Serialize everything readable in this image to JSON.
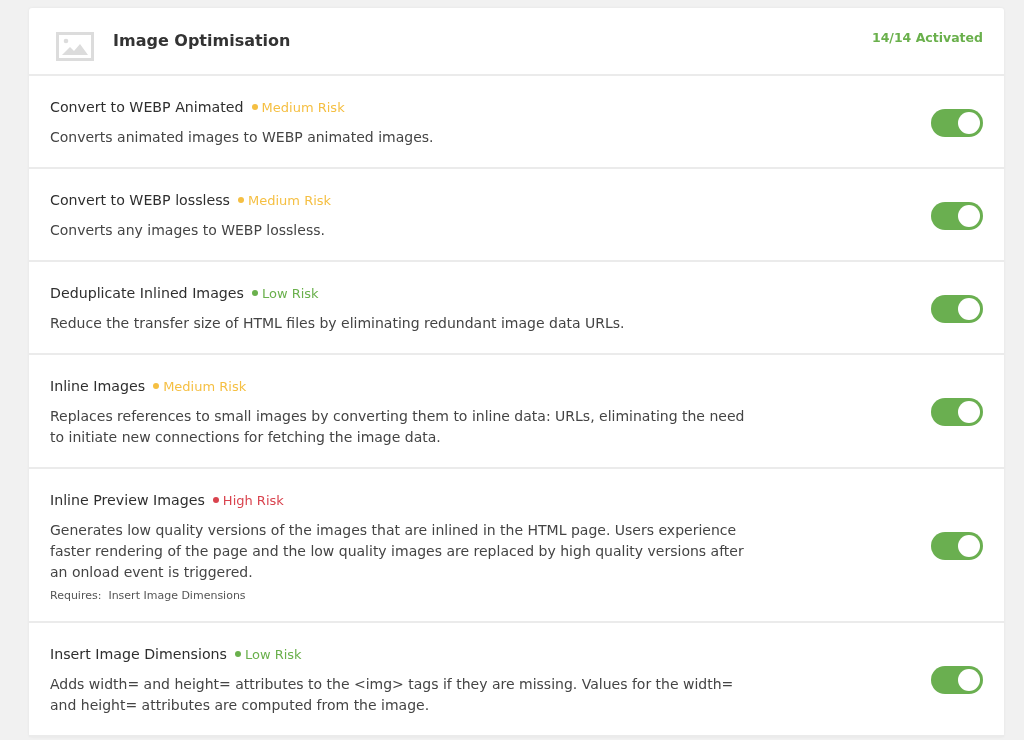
{
  "header": {
    "title": "Image Optimisation",
    "status": "14/14 Activated"
  },
  "features": [
    {
      "title": "Convert to WEBP Animated",
      "risk": {
        "label": "Medium Risk",
        "color": "#f5bf42"
      },
      "description": "Converts animated images to WEBP animated images.",
      "on": true
    },
    {
      "title": "Convert to WEBP lossless",
      "risk": {
        "label": "Medium Risk",
        "color": "#f5bf42"
      },
      "description": "Converts any images to WEBP lossless.",
      "on": true
    },
    {
      "title": "Deduplicate Inlined Images",
      "risk": {
        "label": "Low Risk",
        "color": "#6ab04c"
      },
      "description": "Reduce the transfer size of HTML files by eliminating redundant image data URLs.",
      "on": true
    },
    {
      "title": "Inline Images",
      "risk": {
        "label": "Medium Risk",
        "color": "#f5bf42"
      },
      "description": "Replaces references to small images by converting them to inline data: URLs, eliminating the need to initiate new connections for fetching the image data.",
      "on": true
    },
    {
      "title": "Inline Preview Images",
      "risk": {
        "label": "High Risk",
        "color": "#d9434e"
      },
      "description": "Generates low quality versions of the images that are inlined in the HTML page. Users experience faster rendering of the page and the low quality images are replaced by high quality versions after an onload event is triggered.",
      "requires": "Requires:  Insert Image Dimensions",
      "on": true
    },
    {
      "title": "Insert Image Dimensions",
      "risk": {
        "label": "Low Risk",
        "color": "#6ab04c"
      },
      "description": "Adds width= and height= attributes to the <img> tags if they are missing. Values for the width= and height= attributes are computed from the image.",
      "on": true
    }
  ]
}
